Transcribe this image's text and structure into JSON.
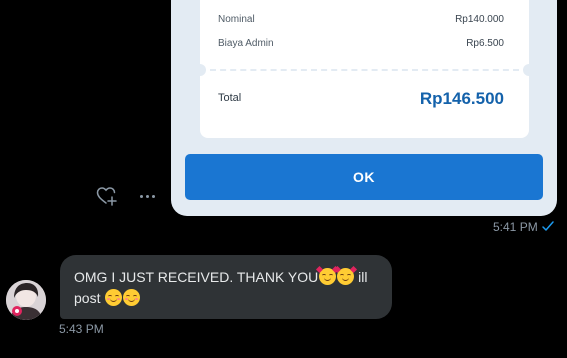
{
  "sent_message": {
    "receipt": {
      "rows": [
        {
          "label": "Nominal",
          "value": "Rp140.000"
        },
        {
          "label": "Biaya Admin",
          "value": "Rp6.500"
        }
      ],
      "total_label": "Total",
      "total_value": "Rp146.500",
      "ok_label": "OK"
    },
    "time": "5:41 PM",
    "read_status_icon": "check-icon"
  },
  "actions": {
    "react_icon": "heart-plus-icon",
    "more_icon": "more-icon"
  },
  "received_message": {
    "text_part1": "OMG I JUST RECEIVED. THANK YOU",
    "text_part2": " ill post ",
    "time": "5:43 PM"
  },
  "colors": {
    "background": "#000000",
    "accent": "#1d9bf0",
    "bubble_incoming": "#2f3336",
    "receipt_total": "#1462ab",
    "ok_button": "#1a76d2"
  }
}
